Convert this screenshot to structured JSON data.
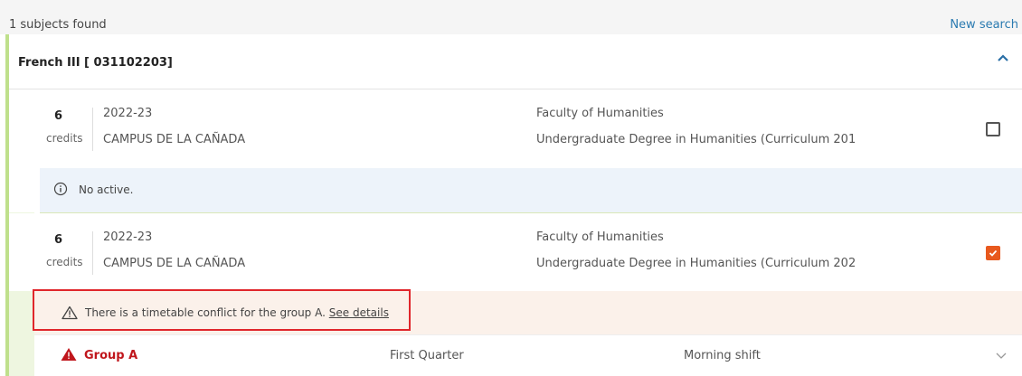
{
  "results": {
    "count_text": "1 subjects found",
    "new_search_label": "New search"
  },
  "subject": {
    "title": "French III [ 031102203]"
  },
  "offerings": [
    {
      "credits": "6",
      "credits_label": "credits",
      "year": "2022-23",
      "campus": "CAMPUS DE LA CAÑADA",
      "faculty": "Faculty of Humanities",
      "degree": "Undergraduate Degree in Humanities (Curriculum 201",
      "selected": false,
      "note": "No active."
    },
    {
      "credits": "6",
      "credits_label": "credits",
      "year": "2022-23",
      "campus": "CAMPUS DE LA CAÑADA",
      "faculty": "Faculty of Humanities",
      "degree": "Undergraduate Degree in Humanities (Curriculum 202",
      "selected": true,
      "warning_text": "There is a timetable conflict for the group A.",
      "warning_link": "See details",
      "group": {
        "name": "Group A",
        "quarter": "First Quarter",
        "shift": "Morning shift"
      }
    }
  ],
  "colors": {
    "accent_green": "#bfe08c",
    "checkbox_on": "#e8591e",
    "link_blue": "#2a7ab0",
    "error_red": "#c0161c",
    "info_bg": "#edf3fa",
    "warning_bg": "#fbf1ea"
  },
  "icons": {
    "collapse": "chevron-up-icon",
    "info": "info-circle-icon",
    "warning": "warning-triangle-icon",
    "group_alert": "alert-triangle-icon",
    "expand": "chevron-down-icon",
    "check": "checkmark-icon"
  }
}
